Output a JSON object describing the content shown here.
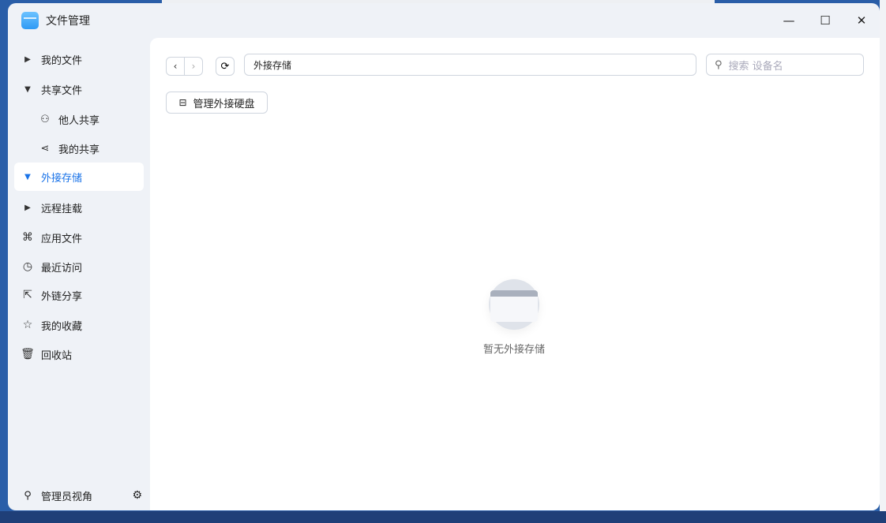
{
  "window": {
    "title": "文件管理",
    "minimize": "—",
    "maximize": "☐",
    "close": "✕"
  },
  "sidebar": {
    "items": [
      {
        "label": "我的文件",
        "icon": "caret-right"
      },
      {
        "label": "共享文件",
        "icon": "caret-down"
      },
      {
        "label": "他人共享",
        "icon": "users"
      },
      {
        "label": "我的共享",
        "icon": "share"
      },
      {
        "label": "外接存储",
        "icon": "caret-down",
        "selected": true
      },
      {
        "label": "远程挂载",
        "icon": "caret-right"
      },
      {
        "label": "应用文件",
        "icon": "apps"
      },
      {
        "label": "最近访问",
        "icon": "clock"
      },
      {
        "label": "外链分享",
        "icon": "external-share"
      },
      {
        "label": "我的收藏",
        "icon": "star"
      },
      {
        "label": "回收站",
        "icon": "trash"
      }
    ],
    "footer": {
      "label": "管理员视角"
    }
  },
  "toolbar": {
    "path": "外接存储",
    "search_placeholder": "搜索 设备名",
    "manage_label": "管理外接硬盘"
  },
  "empty": {
    "text": "暂无外接存储"
  },
  "colors": {
    "accent": "#1a73e8"
  }
}
